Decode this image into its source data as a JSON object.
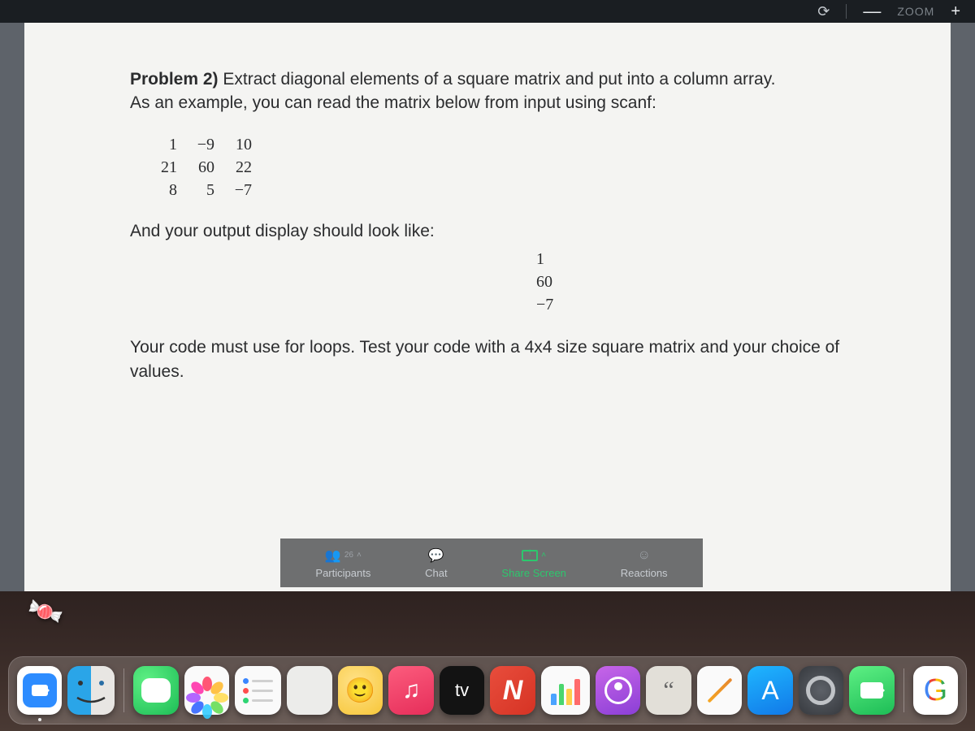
{
  "top": {
    "zoom_label": "ZOOM"
  },
  "problem": {
    "title": "Problem 2)",
    "prompt_line1": " Extract diagonal elements of a square matrix and put into a column array.",
    "prompt_line2": "As an example, you can read the matrix below from input using scanf:",
    "matrix": [
      [
        "1",
        "−9",
        "10"
      ],
      [
        "21",
        "60",
        "22"
      ],
      [
        "8",
        "5",
        "−7"
      ]
    ],
    "mid": "And your output display should look like:",
    "output_col": [
      "1",
      "60",
      "−7"
    ],
    "final": "Your code must use for loops. Test your code with a 4x4 size square matrix and your choice of values."
  },
  "zoom_controls": {
    "participants": {
      "label": "Participants",
      "count": "26"
    },
    "chat": {
      "label": "Chat"
    },
    "share": {
      "label": "Share Screen"
    },
    "reactions": {
      "label": "Reactions"
    }
  },
  "dock": {
    "tv_label": "tv",
    "n_label": "N",
    "quote": "“",
    "g_label": "G",
    "appstore": "A"
  }
}
